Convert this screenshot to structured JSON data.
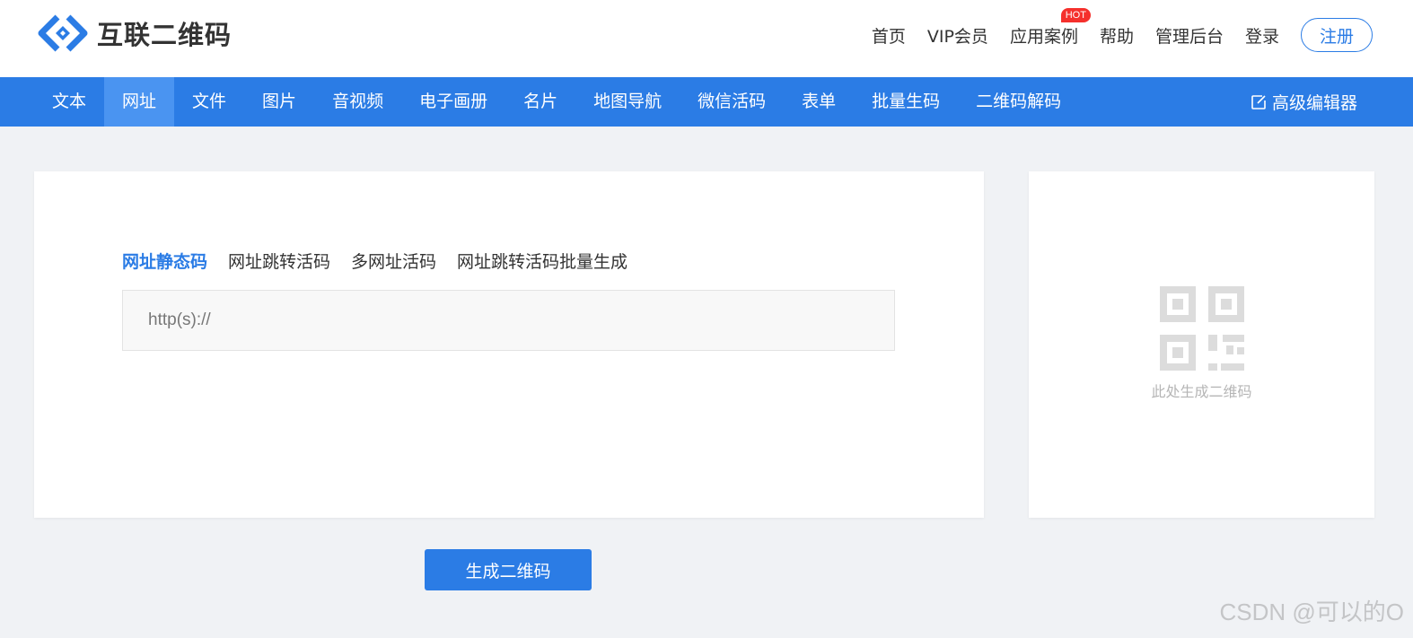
{
  "brand": {
    "name": "互联二维码",
    "color": "#2b7ce5"
  },
  "topnav": {
    "items": [
      "首页",
      "VIP会员",
      "应用案例",
      "帮助",
      "管理后台",
      "登录"
    ],
    "hot_badge": "HOT",
    "register": "注册"
  },
  "mainnav": {
    "items": [
      "文本",
      "网址",
      "文件",
      "图片",
      "音视频",
      "电子画册",
      "名片",
      "地图导航",
      "微信活码",
      "表单",
      "批量生码",
      "二维码解码"
    ],
    "active": "网址",
    "advanced_editor": "高级编辑器"
  },
  "subtabs": {
    "items": [
      "网址静态码",
      "网址跳转活码",
      "多网址活码",
      "网址跳转活码批量生成"
    ],
    "active": "网址静态码"
  },
  "url_input": {
    "placeholder": "http(s)://",
    "value": ""
  },
  "preview": {
    "hint": "此处生成二维码",
    "icon": "qr-code-icon"
  },
  "generate_button": "生成二维码",
  "watermark": "CSDN @可以的O"
}
